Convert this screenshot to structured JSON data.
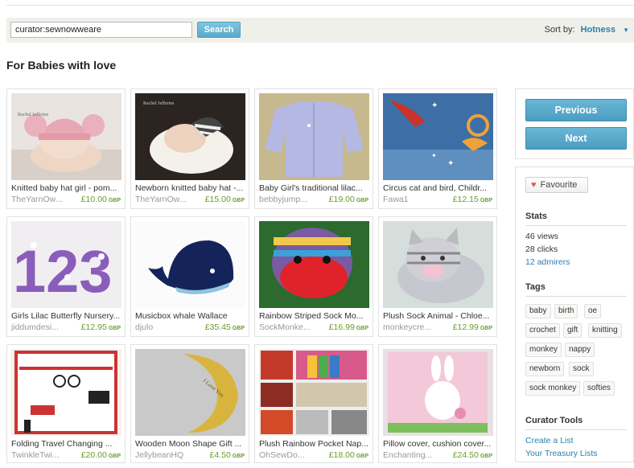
{
  "search": {
    "value": "curator:sewnowweare",
    "button_label": "Search",
    "sort_label": "Sort by:",
    "sort_value": "Hotness"
  },
  "page_title": "For Babies with love",
  "listings": [
    {
      "title": "Knitted baby hat girl - pom...",
      "shop": "TheYarnOw...",
      "price": "£10.00",
      "currency": "GBP"
    },
    {
      "title": "Newborn knitted baby hat -...",
      "shop": "TheYarnOw...",
      "price": "£15.00",
      "currency": "GBP"
    },
    {
      "title": "Baby Girl's traditional lilac...",
      "shop": "bebbyjump...",
      "price": "£19.00",
      "currency": "GBP"
    },
    {
      "title": "Circus cat and bird, Childr...",
      "shop": "Fawa1",
      "price": "£12.15",
      "currency": "GBP"
    },
    {
      "title": "Girls Lilac Butterfly Nursery...",
      "shop": "jiddumdesi...",
      "price": "£12.95",
      "currency": "GBP"
    },
    {
      "title": "Musicbox whale Wallace",
      "shop": "djulo",
      "price": "£35.45",
      "currency": "GBP"
    },
    {
      "title": "Rainbow Striped Sock Mo...",
      "shop": "SockMonke...",
      "price": "£16.99",
      "currency": "GBP"
    },
    {
      "title": "Plush Sock Animal - Chloe...",
      "shop": "monkeycre...",
      "price": "£12.99",
      "currency": "GBP"
    },
    {
      "title": "Folding Travel Changing ...",
      "shop": "TwinkleTwi...",
      "price": "£20.00",
      "currency": "GBP"
    },
    {
      "title": "Wooden Moon Shape Gift ...",
      "shop": "JellybeanHQ",
      "price": "£4.50",
      "currency": "GBP"
    },
    {
      "title": "Plush Rainbow Pocket Nap...",
      "shop": "OhSewDo...",
      "price": "£18.00",
      "currency": "GBP"
    },
    {
      "title": "Pillow cover, cushion cover...",
      "shop": "Enchanting...",
      "price": "£24.50",
      "currency": "GBP"
    }
  ],
  "nav": {
    "previous": "Previous",
    "next": "Next"
  },
  "favourite_label": "Favourite",
  "stats": {
    "title": "Stats",
    "views": "46 views",
    "clicks": "28 clicks",
    "admirers": "12 admirers"
  },
  "tags": {
    "title": "Tags",
    "items": [
      "baby",
      "birth",
      "oe",
      "crochet",
      "gift",
      "knitting",
      "monkey",
      "nappy",
      "newborn",
      "sock",
      "sock monkey",
      "softies"
    ]
  },
  "curator_tools": {
    "title": "Curator Tools",
    "create_list": "Create a List",
    "your_lists": "Your Treasury Lists"
  },
  "colors": {
    "accent_blue": "#4a9ec1",
    "link_blue": "#2a7fb0",
    "price_green": "#6a9d2a",
    "heart_red": "#e05a4a"
  }
}
